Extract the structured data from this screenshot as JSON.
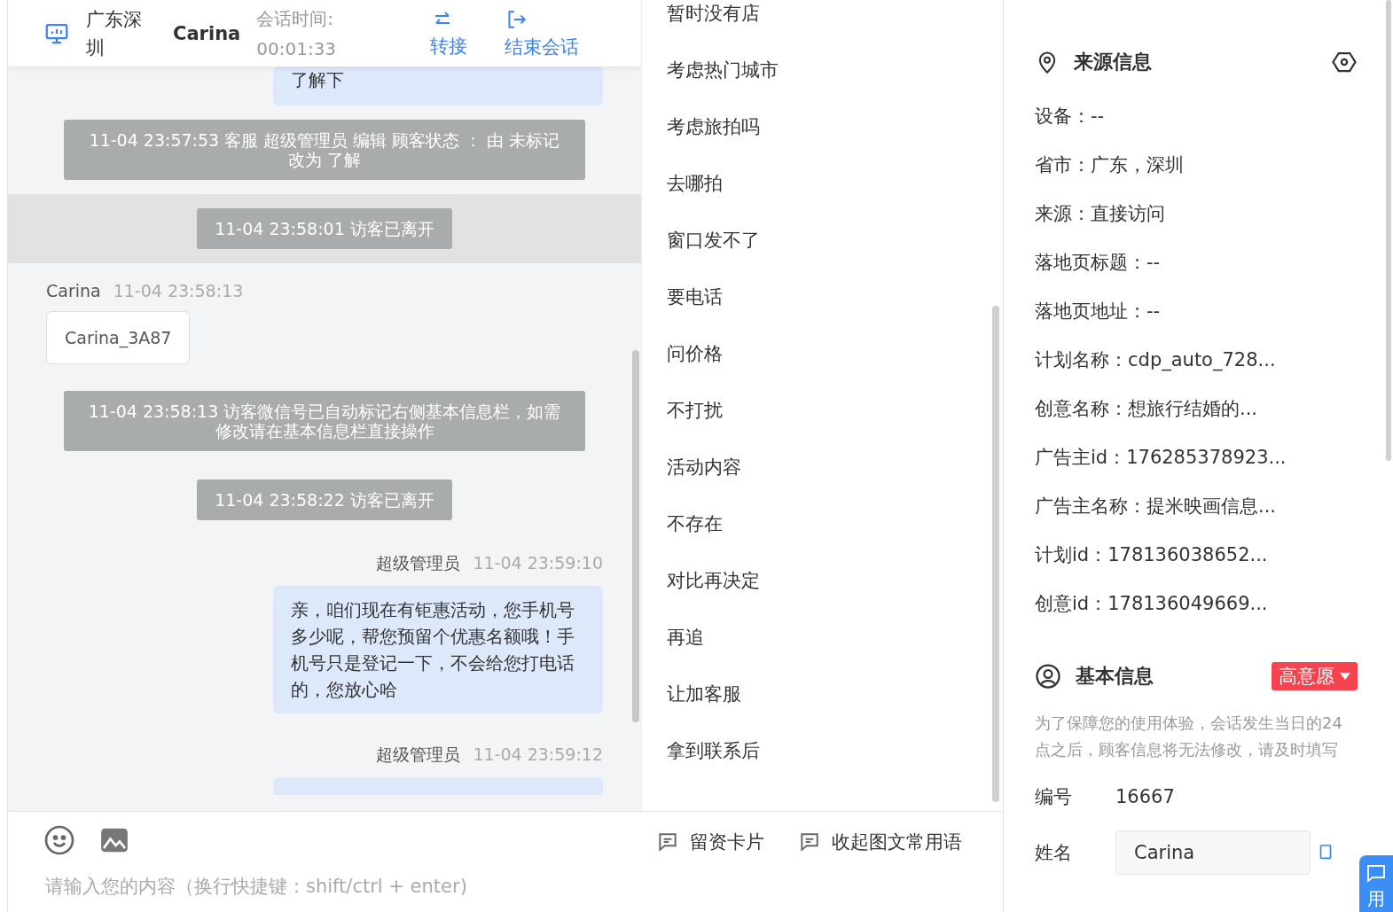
{
  "header": {
    "location": "广东深圳",
    "visitor": "Carina",
    "duration_label": "会话时间:",
    "duration": "00:01:33",
    "actions": [
      {
        "kind": "transfer",
        "label": "转接"
      },
      {
        "kind": "end",
        "label": "结束会话"
      }
    ]
  },
  "messages": [
    {
      "kind": "agent-tail",
      "text": "了解下"
    },
    {
      "kind": "system",
      "highlight": false,
      "text": "11-04 23:57:53 客服 超级管理员 编辑 顾客状态 ： 由 未标记改为 了解"
    },
    {
      "kind": "system",
      "highlight": true,
      "text": "11-04 23:58:01 访客已离开"
    },
    {
      "kind": "visitor",
      "sender": "Carina",
      "time": "11-04 23:58:13",
      "text": "Carina_3A87"
    },
    {
      "kind": "system",
      "highlight": false,
      "text": "11-04 23:58:13 访客微信号已自动标记右侧基本信息栏，如需修改请在基本信息栏直接操作"
    },
    {
      "kind": "system",
      "highlight": false,
      "text": "11-04 23:58:22 访客已离开"
    },
    {
      "kind": "agent",
      "sender": "超级管理员",
      "time": "11-04 23:59:10",
      "text": "亲，咱们现在有钜惠活动，您手机号多少呢，帮您预留个优惠名额哦！手机号只是登记一下，不会给您打电话的，您放心哈"
    },
    {
      "kind": "agent-head",
      "sender": "超级管理员",
      "time": "11-04 23:59:12"
    }
  ],
  "phrases": [
    "暂时没有店",
    "考虑热门城市",
    "考虑旅拍吗",
    "去哪拍",
    "窗口发不了",
    "要电话",
    "问价格",
    "不打扰",
    "活动内容",
    "不存在",
    "对比再决定",
    "再追",
    "让加客服",
    "拿到联系后"
  ],
  "composer": {
    "tools": [
      "留资卡片",
      "收起图文常用语"
    ],
    "placeholder": "请输入您的内容（换行快捷键：shift/ctrl + enter)"
  },
  "source_info": {
    "title": "来源信息",
    "items": [
      "设备：--",
      "省市：广东，深圳",
      "来源：直接访问",
      "落地页标题：--",
      "落地页地址：--",
      "计划名称：cdp_auto_728...",
      "创意名称：想旅行结婚的...",
      "广告主id：176285378923...",
      "广告主名称：提米映画信息...",
      "计划id：178136038652...",
      "创意id：178136049669..."
    ]
  },
  "basic_info": {
    "title": "基本信息",
    "intent": "高意愿",
    "notice": "为了保障您的使用体验，会话发生当日的24点之后，顾客信息将无法修改，请及时填写",
    "fields": [
      {
        "kind": "text",
        "label": "编号",
        "value": "16667"
      },
      {
        "kind": "input",
        "label": "姓名",
        "value": "Carina"
      }
    ]
  },
  "float_button": {
    "label": "用"
  }
}
